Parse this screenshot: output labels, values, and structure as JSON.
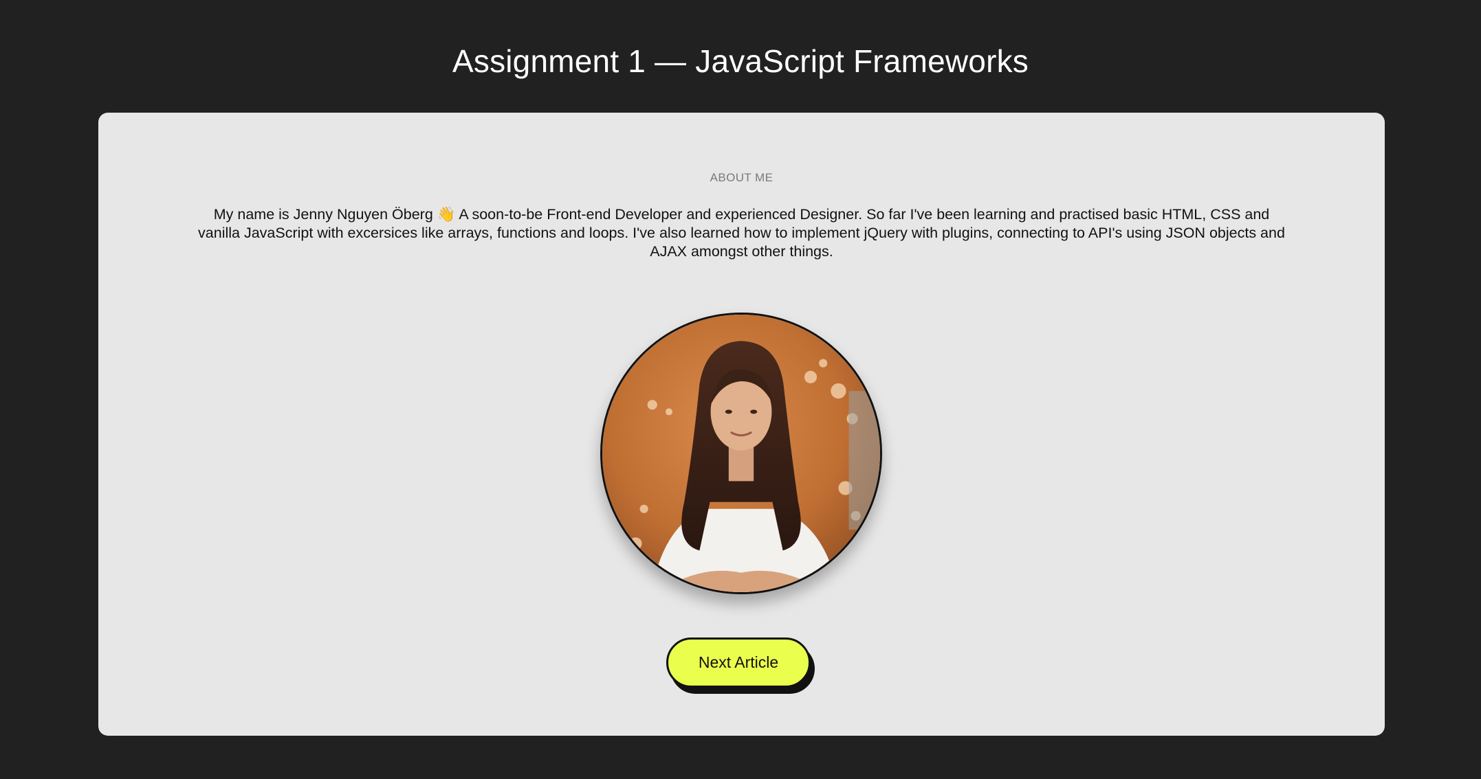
{
  "header": {
    "title": "Assignment 1 — JavaScript Frameworks"
  },
  "about": {
    "label": "ABOUT ME",
    "bio": "My name is Jenny Nguyen Öberg 👋 A soon-to-be Front-end Developer and experienced Designer. So far I've been learning and practised basic HTML, CSS and vanilla JavaScript with excersices like arrays, functions and loops. I've also learned how to implement jQuery with plugins, connecting to API's using JSON objects and AJAX amongst other things."
  },
  "actions": {
    "next_label": "Next Article"
  },
  "colors": {
    "background": "#212121",
    "card": "#e7e7e7",
    "button": "#eaff4d",
    "text": "#111111"
  }
}
